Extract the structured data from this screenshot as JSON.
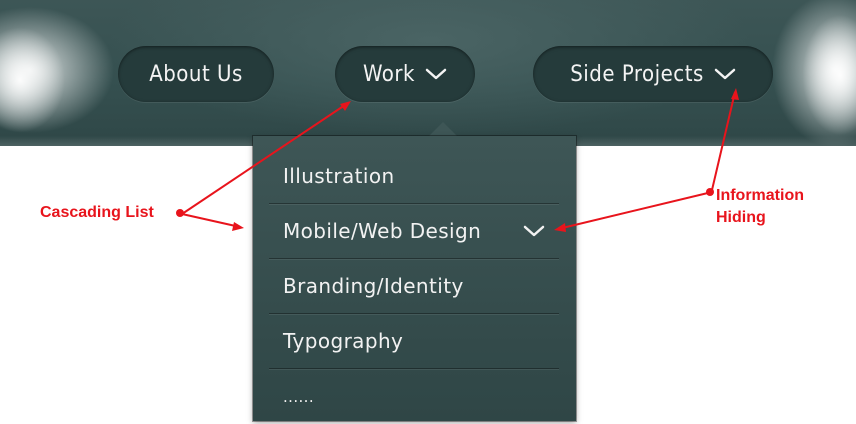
{
  "nav": {
    "items": [
      {
        "label": "About Us"
      },
      {
        "label": "Work"
      },
      {
        "label": "Side Projects"
      }
    ]
  },
  "dropdown": {
    "items": [
      {
        "label": "Illustration"
      },
      {
        "label": "Mobile/Web Design"
      },
      {
        "label": "Branding/Identity"
      },
      {
        "label": "Typography"
      },
      {
        "label": "......"
      }
    ]
  },
  "annotations": {
    "cascading_list": "Cascading List",
    "information_hiding_line1": "Information",
    "information_hiding_line2": "Hiding"
  },
  "colors": {
    "annotation": "#e8141c",
    "header_band": "#355050",
    "nav_pill": "#253b3b",
    "dropdown_bg": "#3e5656"
  }
}
